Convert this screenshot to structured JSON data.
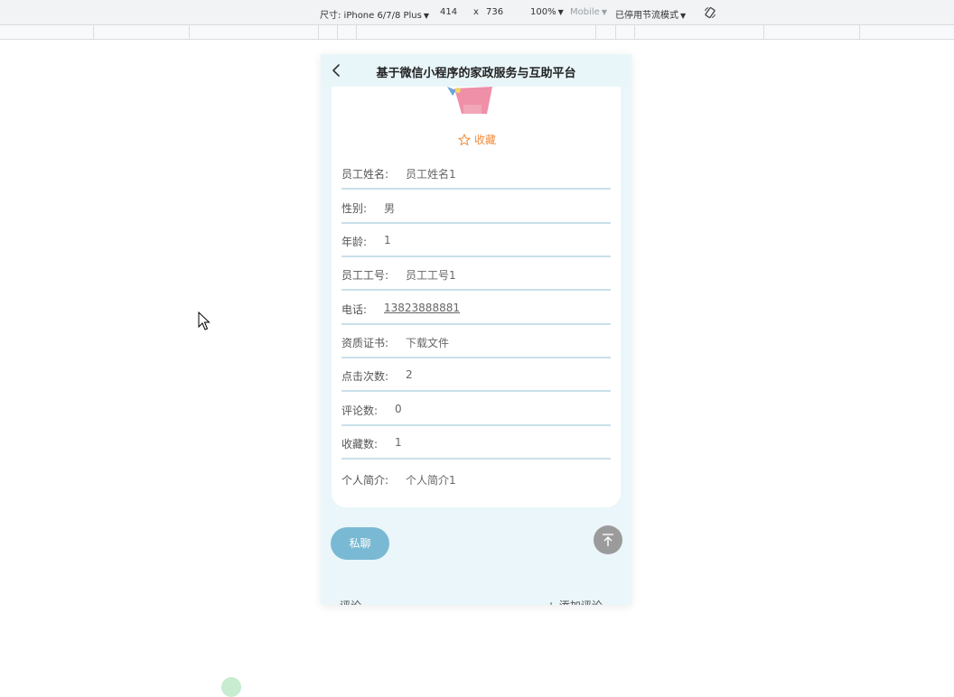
{
  "devtools": {
    "device_label": "尺寸: iPhone 6/7/8 Plus",
    "width_value": "414",
    "times_sign": "x",
    "height_value": "736",
    "zoom_label": "100%",
    "mode_label": "Mobile",
    "throttle_label": "已停用节流模式"
  },
  "app": {
    "title": "基于微信小程序的家政服务与互助平台"
  },
  "detail": {
    "favorite_label": "收藏",
    "fields": [
      {
        "label": "员工姓名:",
        "value": "员工姓名1"
      },
      {
        "label": "性别:",
        "value": "男"
      },
      {
        "label": "年龄:",
        "value": "1"
      },
      {
        "label": "员工工号:",
        "value": "员工工号1"
      },
      {
        "label": "电话:",
        "value": "13823888881"
      },
      {
        "label": "资质证书:",
        "value": "下载文件"
      },
      {
        "label": "点击次数:",
        "value": "2"
      },
      {
        "label": "评论数:",
        "value": "0"
      },
      {
        "label": "收藏数:",
        "value": "1"
      },
      {
        "label": "个人简介:",
        "value": "个人简介1"
      }
    ]
  },
  "actions": {
    "chat_label": "私聊",
    "comments_label": "评论",
    "add_comment_label": "+ 添加评论"
  },
  "colors": {
    "accent_orange": "#f08c3a",
    "chat_button": "#7ab9d3",
    "page_bg": "#eaf6fa"
  }
}
